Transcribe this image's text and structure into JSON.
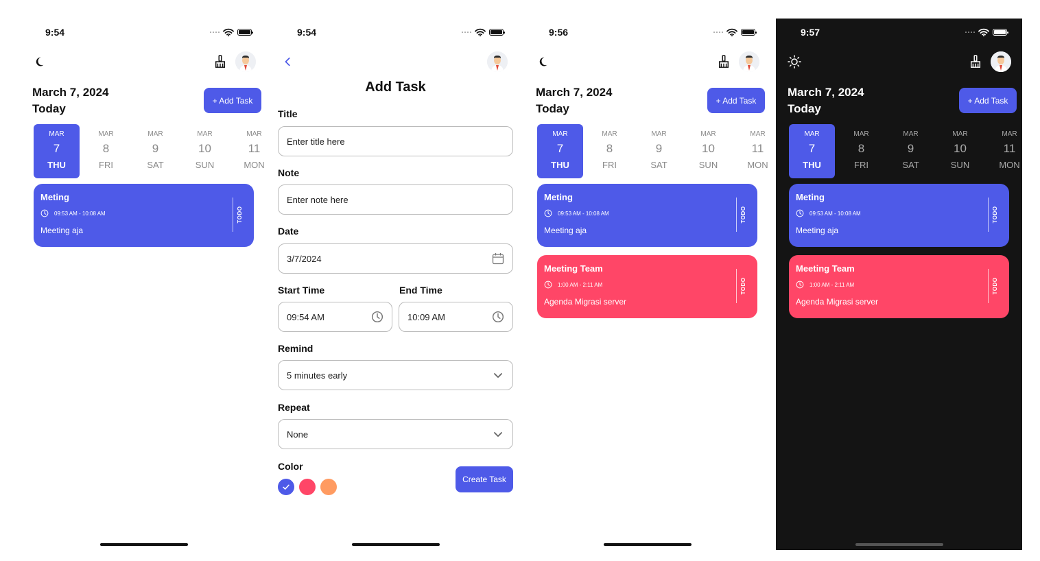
{
  "colors": {
    "primary": "#4e5ae8",
    "pink": "#ff4667",
    "orange": "#ff9b61",
    "dark_bg": "#141414"
  },
  "screens": [
    {
      "time": "9:54",
      "theme_icon": "moon-icon",
      "date": "March 7, 2024",
      "today": "Today",
      "add_task": "+ Add Task",
      "days": [
        {
          "month": "MAR",
          "day": "7",
          "weekday": "THU"
        },
        {
          "month": "MAR",
          "day": "8",
          "weekday": "FRI"
        },
        {
          "month": "MAR",
          "day": "9",
          "weekday": "SAT"
        },
        {
          "month": "MAR",
          "day": "10",
          "weekday": "SUN"
        },
        {
          "month": "MAR",
          "day": "11",
          "weekday": "MON"
        }
      ],
      "tasks": [
        {
          "title": "Meting",
          "time": "09:53 AM - 10:08 AM",
          "note": "Meeting aja",
          "status": "TODO",
          "color": "#4e5ae8"
        }
      ]
    },
    {
      "time": "9:54",
      "form": {
        "title": "Add Task",
        "title_label": "Title",
        "title_placeholder": "Enter title here",
        "note_label": "Note",
        "note_placeholder": "Enter note here",
        "date_label": "Date",
        "date_value": "3/7/2024",
        "start_label": "Start Time",
        "start_value": "09:54 AM",
        "end_label": "End Time",
        "end_value": "10:09 AM",
        "remind_label": "Remind",
        "remind_value": "5 minutes early",
        "repeat_label": "Repeat",
        "repeat_value": "None",
        "color_label": "Color",
        "color_options": [
          "#4e5ae8",
          "#ff4667",
          "#ff9b61"
        ],
        "selected_color": 0,
        "create_label": "Create Task"
      }
    },
    {
      "time": "9:56",
      "theme_icon": "moon-icon",
      "date": "March 7, 2024",
      "today": "Today",
      "add_task": "+ Add Task",
      "days": [
        {
          "month": "MAR",
          "day": "7",
          "weekday": "THU"
        },
        {
          "month": "MAR",
          "day": "8",
          "weekday": "FRI"
        },
        {
          "month": "MAR",
          "day": "9",
          "weekday": "SAT"
        },
        {
          "month": "MAR",
          "day": "10",
          "weekday": "SUN"
        },
        {
          "month": "MAR",
          "day": "11",
          "weekday": "MON"
        }
      ],
      "tasks": [
        {
          "title": "Meting",
          "time": "09:53 AM - 10:08 AM",
          "note": "Meeting aja",
          "status": "TODO",
          "color": "#4e5ae8"
        },
        {
          "title": "Meeting Team",
          "time": "1:00 AM - 2:11 AM",
          "note": "Agenda Migrasi server",
          "status": "TODO",
          "color": "#ff4667"
        }
      ]
    },
    {
      "time": "9:57",
      "theme_icon": "sun-icon",
      "date": "March 7, 2024",
      "today": "Today",
      "add_task": "+ Add Task",
      "days": [
        {
          "month": "MAR",
          "day": "7",
          "weekday": "THU"
        },
        {
          "month": "MAR",
          "day": "8",
          "weekday": "FRI"
        },
        {
          "month": "MAR",
          "day": "9",
          "weekday": "SAT"
        },
        {
          "month": "MAR",
          "day": "10",
          "weekday": "SUN"
        },
        {
          "month": "MAR",
          "day": "11",
          "weekday": "MON"
        }
      ],
      "tasks": [
        {
          "title": "Meting",
          "time": "09:53 AM - 10:08 AM",
          "note": "Meeting aja",
          "status": "TODO",
          "color": "#4e5ae8"
        },
        {
          "title": "Meeting Team",
          "time": "1:00 AM - 2:11 AM",
          "note": "Agenda Migrasi server",
          "status": "TODO",
          "color": "#ff4667"
        }
      ]
    }
  ]
}
